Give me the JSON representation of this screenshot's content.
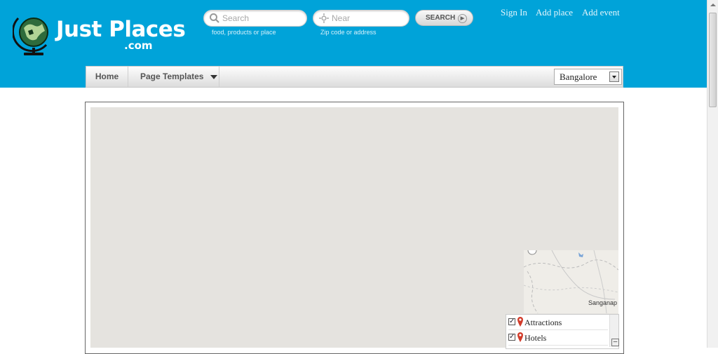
{
  "site": {
    "name": "Just Places",
    "suffix": ".com"
  },
  "search": {
    "placeholder": "Search",
    "hint": "food, products or place",
    "near_placeholder": "Near",
    "near_hint": "Zip code or address",
    "button_label": "SEARCH"
  },
  "top_links": [
    "Sign In",
    "Add place",
    "Add event"
  ],
  "nav": {
    "home": "Home",
    "templates": "Page Templates",
    "city": "Bangalore"
  },
  "map": {
    "thumbnail_label": "Sanganap"
  },
  "legend": {
    "items": [
      "Attractions",
      "Hotels"
    ]
  },
  "colors": {
    "header_bg": "#00a3d9",
    "map_bg": "#e5e3df"
  },
  "icons": [
    "globe-logo-icon",
    "search-icon",
    "location-icon",
    "arrow-right-icon",
    "dropdown-caret-icon",
    "map-pin-icon"
  ]
}
